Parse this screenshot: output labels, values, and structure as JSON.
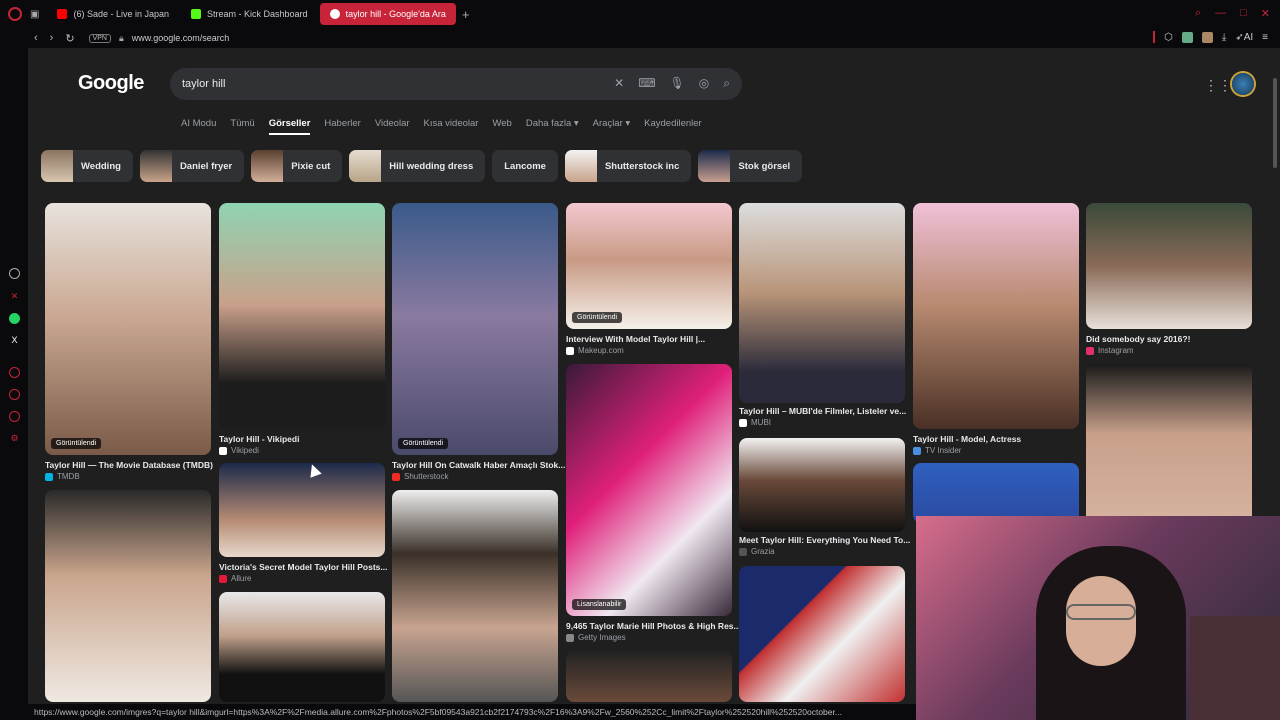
{
  "browser": {
    "tabs": [
      {
        "label": "(6) Sade - Live in Japan",
        "color": "#ff0000"
      },
      {
        "label": "Stream - Kick Dashboard",
        "color": "#53fc18"
      },
      {
        "label": "taylor hill - Google'da Ara",
        "color": "#ffffff"
      }
    ],
    "new_tab": "+",
    "vpn": "VPN",
    "url": "www.google.com/search",
    "ai_label": "AI"
  },
  "google": {
    "logo": "Google",
    "query": "taylor hill",
    "nav_tabs": [
      "AI Modu",
      "Tümü",
      "Görseller",
      "Haberler",
      "Videolar",
      "Kısa videolar",
      "Web",
      "Daha fazla ▾",
      "Araçlar ▾",
      "Kaydedilenler"
    ],
    "chips": [
      {
        "label": "Wedding",
        "img": true
      },
      {
        "label": "Daniel fryer",
        "img": true
      },
      {
        "label": "Pixie cut",
        "img": true
      },
      {
        "label": "Hill wedding dress",
        "img": true
      },
      {
        "label": "Lancome",
        "img": false
      },
      {
        "label": "Shutterstock inc",
        "img": true
      },
      {
        "label": "Stok görsel",
        "img": true
      }
    ],
    "results": [
      {
        "caption": "Taylor Hill — The Movie Database (TMDB)",
        "source": "TMDB",
        "badge": "Görüntülendi"
      },
      {
        "caption": "Taylor Hill - Vikipedi",
        "source": "Vikipedi",
        "badge": ""
      },
      {
        "caption": "Taylor Hill On Catwalk Haber Amaçlı Stok...",
        "source": "Shutterstock",
        "badge": "Görüntülendi"
      },
      {
        "caption": "Interview With Model Taylor Hill |...",
        "source": "Makeup.com",
        "badge": "Görüntülendi"
      },
      {
        "caption": "Taylor Hill – MUBI'de Filmler, Listeler ve...",
        "source": "MUBI",
        "badge": ""
      },
      {
        "caption": "Taylor Hill - Model, Actress",
        "source": "TV Insider",
        "badge": ""
      },
      {
        "caption": "Did somebody say 2016?!",
        "source": "Instagram",
        "badge": ""
      },
      {
        "caption": "Victoria's Secret Model Taylor Hill Posts...",
        "source": "Allure",
        "badge": ""
      },
      {
        "caption": "9,465 Taylor Marie Hill Photos & High Res...",
        "source": "Getty Images",
        "badge": "Lisanslanabilir"
      },
      {
        "caption": "Meet Taylor Hill: Everything You Need To...",
        "source": "Grazia",
        "badge": ""
      }
    ]
  },
  "status_bar": "https://www.google.com/imgres?q=taylor hill&imgurl=https%3A%2F%2Fmedia.allure.com%2Fphotos%2F5bf09543a921cb2f2174793c%2F16%3A9%2Fw_2560%252Cc_limit%2Ftaylor%252520hill%252520october..."
}
